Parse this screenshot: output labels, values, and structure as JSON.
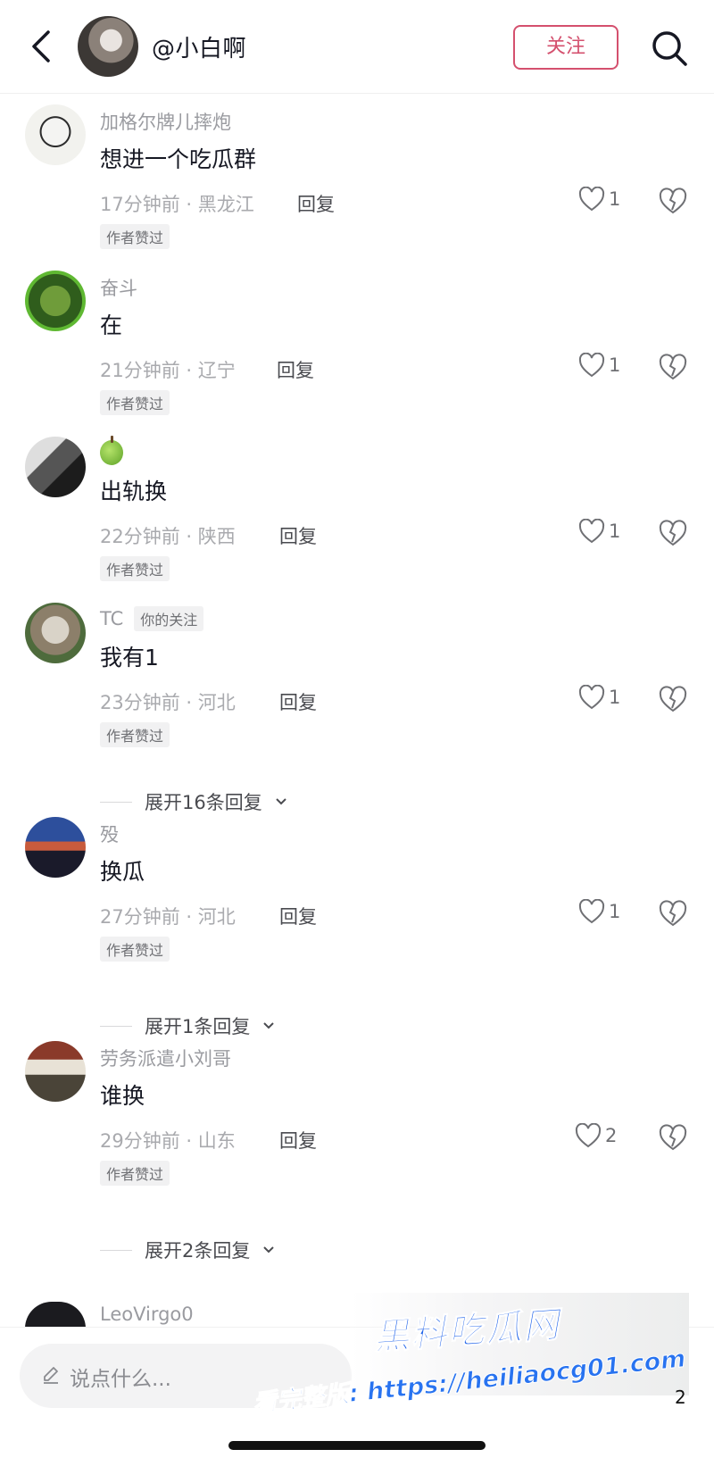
{
  "header": {
    "username": "@小白啊",
    "follow_label": "关注",
    "back_icon": "chevron-left-icon",
    "search_icon": "search-icon"
  },
  "comments": [
    {
      "nick": "加格尔牌儿摔炮",
      "text": "想进一个吃瓜群",
      "meta": "17分钟前 · 黑龙江",
      "reply": "回复",
      "likes": "1",
      "badge": "作者赞过"
    },
    {
      "nick": "奋斗",
      "text": "在",
      "meta": "21分钟前 · 辽宁",
      "reply": "回复",
      "likes": "1",
      "badge": "作者赞过"
    },
    {
      "nick": "",
      "text": "出轨换",
      "meta": "22分钟前 · 陕西",
      "reply": "回复",
      "likes": "1",
      "badge": "作者赞过"
    },
    {
      "nick": "TC",
      "tag": "你的关注",
      "text": "我有1",
      "meta": "23分钟前 · 河北",
      "reply": "回复",
      "likes": "1",
      "badge": "作者赞过",
      "expand": "展开16条回复"
    },
    {
      "nick": "殁",
      "text": "换瓜",
      "meta": "27分钟前 · 河北",
      "reply": "回复",
      "likes": "1",
      "badge": "作者赞过",
      "expand": "展开1条回复"
    },
    {
      "nick": "劳务派遣小刘哥",
      "text": "谁换",
      "meta": "29分钟前 · 山东",
      "reply": "回复",
      "likes": "2",
      "badge": "作者赞过",
      "expand": "展开2条回复"
    }
  ],
  "partial_comment": {
    "nick": "LeoVirgo0"
  },
  "bottom": {
    "input_placeholder": "说点什么...",
    "count": "2"
  },
  "watermark": {
    "title": "黑料吃瓜网",
    "url": "看完整版: https://heiliaocg01.com"
  },
  "colors": {
    "accent": "#d4506e",
    "watermark_blue": "#1f63ea"
  }
}
